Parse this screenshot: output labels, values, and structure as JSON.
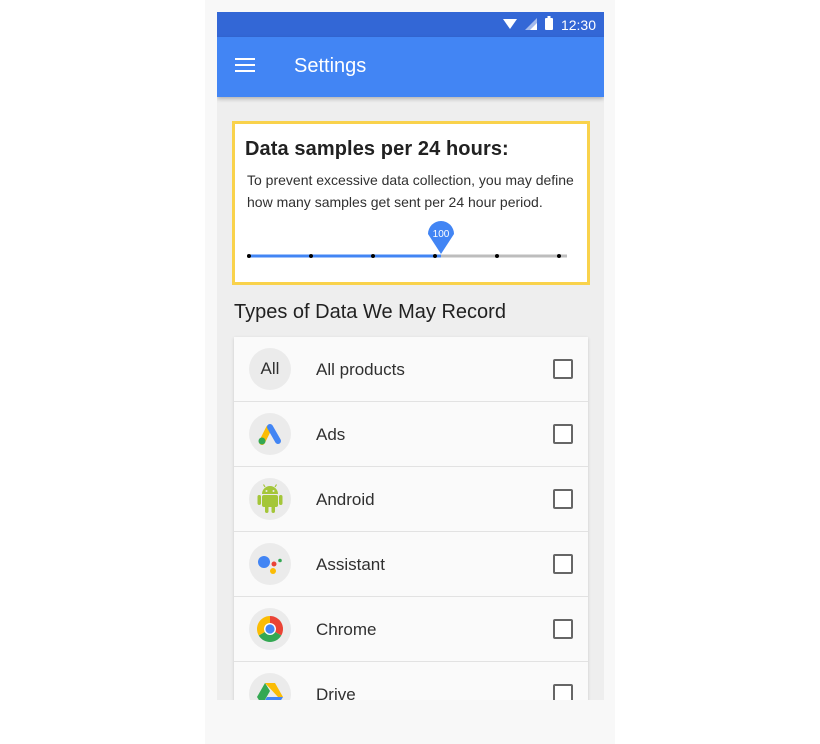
{
  "status_bar": {
    "time": "12:30",
    "icons": [
      "wifi-icon",
      "signal-icon",
      "battery-icon"
    ]
  },
  "app_bar": {
    "title": "Settings",
    "menu_icon": "hamburger-menu-icon"
  },
  "samples_card": {
    "title": "Data samples per 24 hours:",
    "description": "To prevent excessive data collection, you may define how many samples get sent per 24 hour period.",
    "slider": {
      "value_label": "100",
      "selected_step_index": 3,
      "step_count": 6
    }
  },
  "data_types": {
    "heading": "Types of Data We May Record",
    "items": [
      {
        "label": "All products",
        "icon": "all-text-icon",
        "icon_text": "All",
        "checked": false
      },
      {
        "label": "Ads",
        "icon": "google-ads-icon",
        "checked": false
      },
      {
        "label": "Android",
        "icon": "android-icon",
        "checked": false
      },
      {
        "label": "Assistant",
        "icon": "google-assistant-icon",
        "checked": false
      },
      {
        "label": "Chrome",
        "icon": "chrome-icon",
        "checked": false
      },
      {
        "label": "Drive",
        "icon": "google-drive-icon",
        "checked": false
      }
    ]
  },
  "colors": {
    "status_bar": "#3367d6",
    "app_bar": "#4285f4",
    "highlight_border": "#f9d24b",
    "slider_active": "#4285f4",
    "slider_inactive": "#bdbdbd"
  }
}
